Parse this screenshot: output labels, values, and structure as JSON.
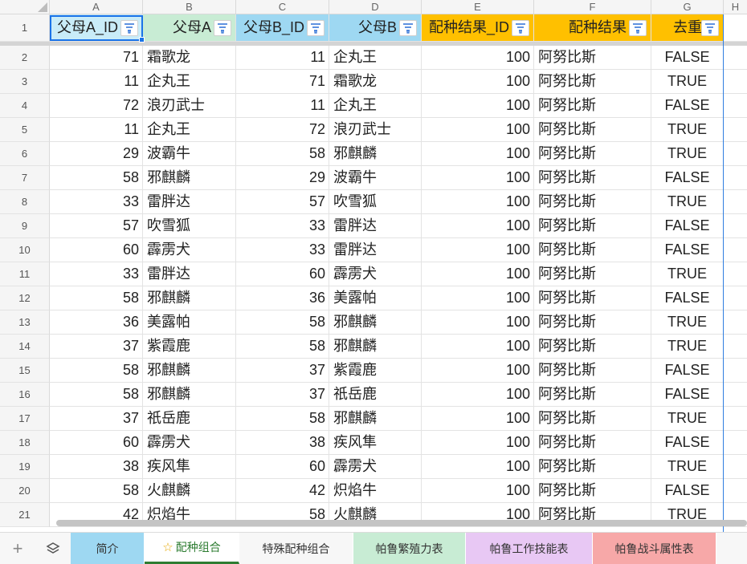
{
  "columns": [
    "A",
    "B",
    "C",
    "D",
    "E",
    "F",
    "G",
    "H"
  ],
  "header_row_number": "1",
  "headers": [
    "父母A_ID",
    "父母A",
    "父母B_ID",
    "父母B",
    "配种结果_ID",
    "配种结果",
    "去重"
  ],
  "header_colors": [
    "#c9ecf8",
    "#c8ecd4",
    "#9ed8f2",
    "#9ed8f2",
    "#ffc000",
    "#ffc000",
    "#ffc000"
  ],
  "rows": [
    {
      "n": "2",
      "a_id": "71",
      "a": "霜歌龙",
      "b_id": "11",
      "b": "企丸王",
      "r_id": "100",
      "r": "阿努比斯",
      "dedup": "FALSE"
    },
    {
      "n": "3",
      "a_id": "11",
      "a": "企丸王",
      "b_id": "71",
      "b": "霜歌龙",
      "r_id": "100",
      "r": "阿努比斯",
      "dedup": "TRUE"
    },
    {
      "n": "4",
      "a_id": "72",
      "a": "浪刃武士",
      "b_id": "11",
      "b": "企丸王",
      "r_id": "100",
      "r": "阿努比斯",
      "dedup": "FALSE"
    },
    {
      "n": "5",
      "a_id": "11",
      "a": "企丸王",
      "b_id": "72",
      "b": "浪刃武士",
      "r_id": "100",
      "r": "阿努比斯",
      "dedup": "TRUE"
    },
    {
      "n": "6",
      "a_id": "29",
      "a": "波霸牛",
      "b_id": "58",
      "b": "邪麒麟",
      "r_id": "100",
      "r": "阿努比斯",
      "dedup": "TRUE"
    },
    {
      "n": "7",
      "a_id": "58",
      "a": "邪麒麟",
      "b_id": "29",
      "b": "波霸牛",
      "r_id": "100",
      "r": "阿努比斯",
      "dedup": "FALSE"
    },
    {
      "n": "8",
      "a_id": "33",
      "a": "雷胖达",
      "b_id": "57",
      "b": "吹雪狐",
      "r_id": "100",
      "r": "阿努比斯",
      "dedup": "TRUE"
    },
    {
      "n": "9",
      "a_id": "57",
      "a": "吹雪狐",
      "b_id": "33",
      "b": "雷胖达",
      "r_id": "100",
      "r": "阿努比斯",
      "dedup": "FALSE"
    },
    {
      "n": "10",
      "a_id": "60",
      "a": "霹雳犬",
      "b_id": "33",
      "b": "雷胖达",
      "r_id": "100",
      "r": "阿努比斯",
      "dedup": "FALSE"
    },
    {
      "n": "11",
      "a_id": "33",
      "a": "雷胖达",
      "b_id": "60",
      "b": "霹雳犬",
      "r_id": "100",
      "r": "阿努比斯",
      "dedup": "TRUE"
    },
    {
      "n": "12",
      "a_id": "58",
      "a": "邪麒麟",
      "b_id": "36",
      "b": "美露帕",
      "r_id": "100",
      "r": "阿努比斯",
      "dedup": "FALSE"
    },
    {
      "n": "13",
      "a_id": "36",
      "a": "美露帕",
      "b_id": "58",
      "b": "邪麒麟",
      "r_id": "100",
      "r": "阿努比斯",
      "dedup": "TRUE"
    },
    {
      "n": "14",
      "a_id": "37",
      "a": "紫霞鹿",
      "b_id": "58",
      "b": "邪麒麟",
      "r_id": "100",
      "r": "阿努比斯",
      "dedup": "TRUE"
    },
    {
      "n": "15",
      "a_id": "58",
      "a": "邪麒麟",
      "b_id": "37",
      "b": "紫霞鹿",
      "r_id": "100",
      "r": "阿努比斯",
      "dedup": "FALSE"
    },
    {
      "n": "16",
      "a_id": "58",
      "a": "邪麒麟",
      "b_id": "37",
      "b": "祇岳鹿",
      "r_id": "100",
      "r": "阿努比斯",
      "dedup": "FALSE"
    },
    {
      "n": "17",
      "a_id": "37",
      "a": "祇岳鹿",
      "b_id": "58",
      "b": "邪麒麟",
      "r_id": "100",
      "r": "阿努比斯",
      "dedup": "TRUE"
    },
    {
      "n": "18",
      "a_id": "60",
      "a": "霹雳犬",
      "b_id": "38",
      "b": "疾风隼",
      "r_id": "100",
      "r": "阿努比斯",
      "dedup": "FALSE"
    },
    {
      "n": "19",
      "a_id": "38",
      "a": "疾风隼",
      "b_id": "60",
      "b": "霹雳犬",
      "r_id": "100",
      "r": "阿努比斯",
      "dedup": "TRUE"
    },
    {
      "n": "20",
      "a_id": "58",
      "a": "火麒麟",
      "b_id": "42",
      "b": "炽焰牛",
      "r_id": "100",
      "r": "阿努比斯",
      "dedup": "FALSE"
    },
    {
      "n": "21",
      "a_id": "42",
      "a": "炽焰牛",
      "b_id": "58",
      "b": "火麒麟",
      "r_id": "100",
      "r": "阿努比斯",
      "dedup": "TRUE"
    }
  ],
  "tabbar": {
    "add_icon": "plus-icon",
    "layers_icon": "layers-icon",
    "tabs": [
      {
        "label": "简介",
        "color": "#9ed8f2"
      },
      {
        "label": "配种组合",
        "color": "#ffffff",
        "active": "true",
        "icon": "star-icon"
      },
      {
        "label": "特殊配种组合",
        "color": "#f7f7f7"
      },
      {
        "label": "帕鲁繁殖力表",
        "color": "#c8ecd4"
      },
      {
        "label": "帕鲁工作技能表",
        "color": "#e8c8f4"
      },
      {
        "label": "帕鲁战斗属性表",
        "color": "#f7a8a8"
      }
    ]
  },
  "colors": {
    "selection": "#1a73e8",
    "active_tab": "#2e7d32"
  }
}
